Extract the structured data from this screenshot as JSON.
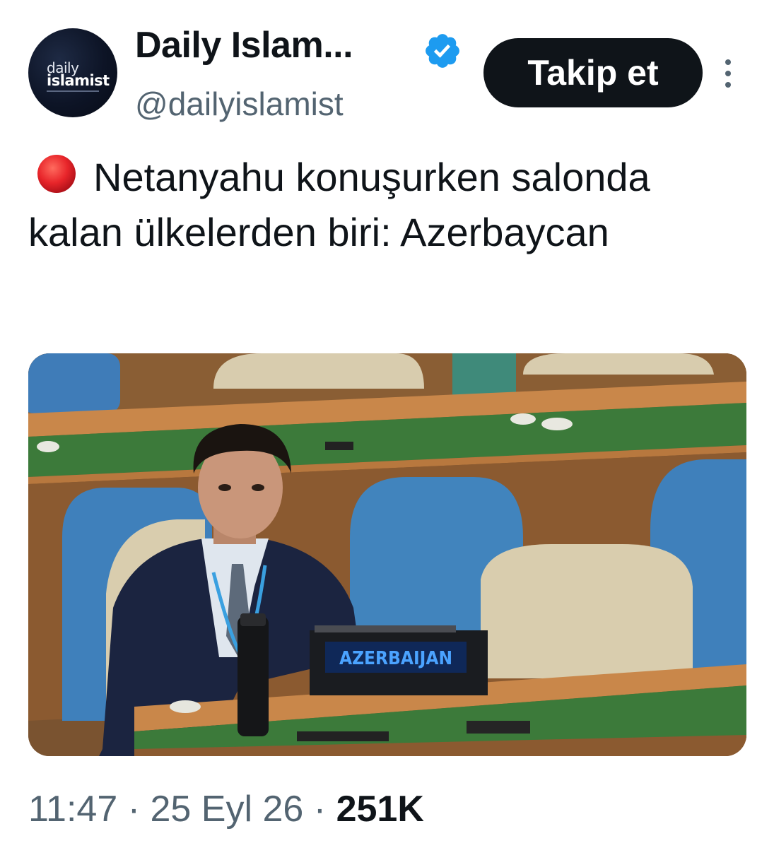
{
  "account": {
    "display_name": "Daily Islam...",
    "handle": "@dailyislamist",
    "avatar_line1": "daily",
    "avatar_line2": "islamist",
    "verified": true
  },
  "actions": {
    "follow_label": "Takip et",
    "more_icon": "more-vertical-icon"
  },
  "tweet": {
    "emoji": "red-circle",
    "text": "Netanyahu konuşurken salonda kalan ülkelerden biri: Azerbaycan"
  },
  "image": {
    "nameplate_text": "AZERBAIJAN"
  },
  "meta": {
    "time": "11:47",
    "separator": "·",
    "date": "25 Eyl 26",
    "views": "251K"
  },
  "colors": {
    "text_primary": "#0f1419",
    "text_secondary": "#536471",
    "verified_blue": "#1d9bf0",
    "red_dot": "#e0245e"
  }
}
